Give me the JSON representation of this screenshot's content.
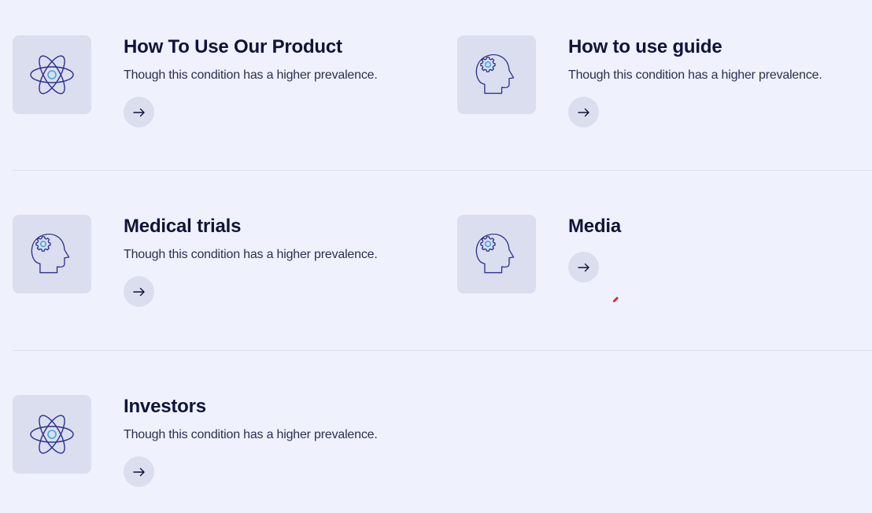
{
  "cards": [
    {
      "icon": "atom-icon",
      "title": "How To Use Our Product",
      "description": "Though this condition has a higher prevalence."
    },
    {
      "icon": "head-gear-icon",
      "title": "How to use guide",
      "description": "Though this condition has a higher prevalence."
    },
    {
      "icon": "head-gear-icon",
      "title": "Medical trials",
      "description": "Though this condition has a higher prevalence."
    },
    {
      "icon": "head-gear-icon",
      "title": "Media",
      "description": ""
    },
    {
      "icon": "atom-icon",
      "title": "Investors",
      "description": "Though this condition has a higher prevalence."
    }
  ],
  "colors": {
    "background": "#eff2fc",
    "tile": "#dbdeee",
    "icon_stroke": "#2b2f8f",
    "icon_accent": "#3fa9e0",
    "title": "#0f1438",
    "text": "#2a2f52"
  }
}
